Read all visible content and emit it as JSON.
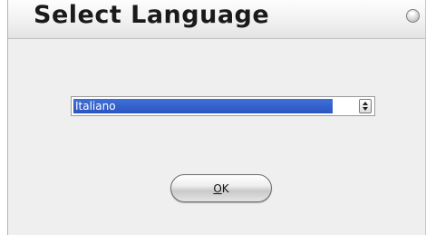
{
  "dialog": {
    "title": "Select Language",
    "close_icon": "close-icon"
  },
  "language_select": {
    "selected": "Italiano",
    "arrows_icon": "up-down-arrows-icon"
  },
  "ok_button": {
    "mnemonic": "O",
    "rest": "K"
  },
  "colors": {
    "selection": "#2b55c2",
    "dialog_background": "#efefef"
  }
}
